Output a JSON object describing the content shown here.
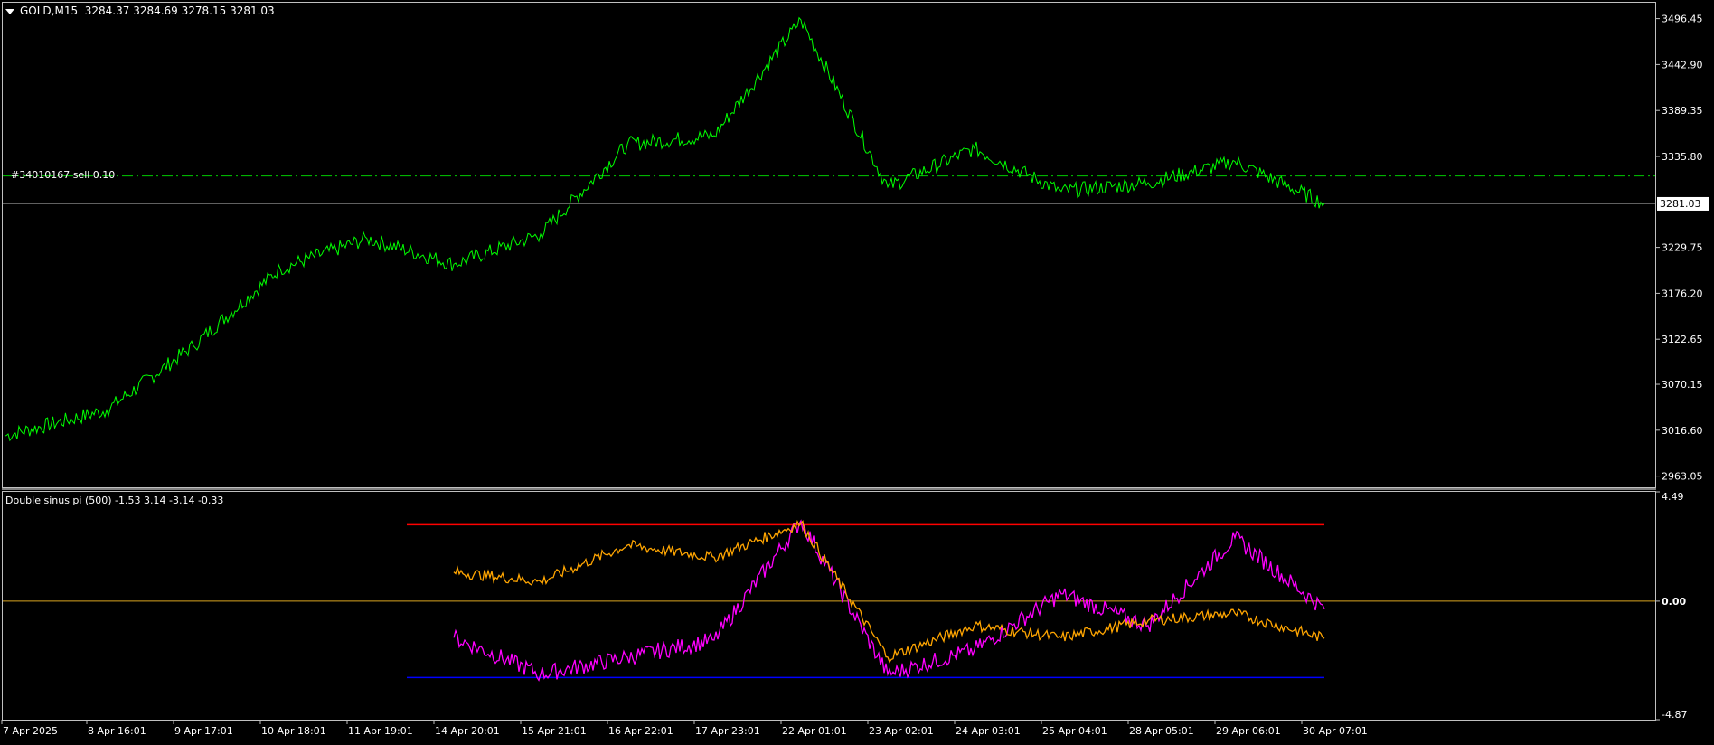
{
  "main_panel": {
    "symbol": "GOLD,M15",
    "ohlc": "3284.37 3284.69 3278.15 3281.03",
    "order_label": "#34010167 sell 0.10",
    "current_price": "3281.03",
    "price_ticks": [
      "3496.45",
      "3442.90",
      "3389.35",
      "3335.80",
      "3229.75",
      "3176.20",
      "3122.65",
      "3070.15",
      "3016.60",
      "2963.05"
    ],
    "order_level": 3313,
    "series_color": "#00ff00",
    "order_line_color": "#00cc00"
  },
  "indicator_panel": {
    "title": "Double sinus pi (500) -1.53 3.14 -3.14 -0.33",
    "y_ticks": [
      "4.49",
      "0.00",
      "-4.87"
    ],
    "upper_level": 3.14,
    "lower_level": -3.14,
    "zero_level": 0,
    "colors": {
      "magenta": "#ff00ff",
      "orange": "#ffa500",
      "upper": "#ff0000",
      "lower": "#0000ff",
      "zero": "#daa520"
    }
  },
  "time_axis": {
    "labels": [
      "7 Apr 2025",
      "8 Apr 16:01",
      "9 Apr 17:01",
      "10 Apr 18:01",
      "11 Apr 19:01",
      "14 Apr 20:01",
      "15 Apr 21:01",
      "16 Apr 22:01",
      "17 Apr 23:01",
      "22 Apr 01:01",
      "23 Apr 02:01",
      "24 Apr 03:01",
      "25 Apr 04:01",
      "28 Apr 05:01",
      "29 Apr 06:01",
      "30 Apr 07:01"
    ]
  },
  "chart_data": [
    {
      "type": "line",
      "title": "GOLD,M15",
      "x": [
        "7 Apr 2025",
        "8 Apr 16:01",
        "9 Apr 17:01",
        "10 Apr 18:01",
        "11 Apr 19:01",
        "14 Apr 20:01",
        "15 Apr 21:01",
        "16 Apr 22:01",
        "17 Apr 23:01",
        "22 Apr 01:01",
        "23 Apr 02:01",
        "24 Apr 03:01",
        "25 Apr 04:01",
        "28 Apr 05:01",
        "29 Apr 06:01",
        "30 Apr 07:01"
      ],
      "series": [
        {
          "values": [
            3010,
            3040,
            3115,
            3205,
            3240,
            3210,
            3245,
            3350,
            3360,
            3495,
            3300,
            3345,
            3295,
            3305,
            3330,
            3281
          ]
        }
      ],
      "ylim": [
        2950,
        3515
      ]
    },
    {
      "type": "line",
      "title": "Double sinus pi (500) -1.53 3.14 -3.14 -0.33",
      "x": [
        "7 Apr 2025",
        "8 Apr 16:01",
        "9 Apr 17:01",
        "10 Apr 18:01",
        "11 Apr 19:01",
        "14 Apr 20:01",
        "15 Apr 21:01",
        "16 Apr 22:01",
        "17 Apr 23:01",
        "22 Apr 01:01",
        "23 Apr 02:01",
        "24 Apr 03:01",
        "25 Apr 04:01",
        "28 Apr 05:01",
        "29 Apr 06:01",
        "30 Apr 07:01"
      ],
      "series": [
        {
          "values": [
            null,
            null,
            null,
            null,
            null,
            -1.5,
            -3.0,
            -2.3,
            -1.6,
            3.3,
            -3.0,
            -2.0,
            0.3,
            -1.0,
            2.6,
            -0.33
          ]
        },
        {
          "values": [
            null,
            null,
            null,
            null,
            null,
            1.2,
            0.8,
            2.3,
            1.8,
            3.2,
            -2.3,
            -1.0,
            -1.5,
            -0.8,
            -0.5,
            -1.53
          ]
        }
      ],
      "ylim": [
        -4.87,
        4.49
      ]
    }
  ]
}
